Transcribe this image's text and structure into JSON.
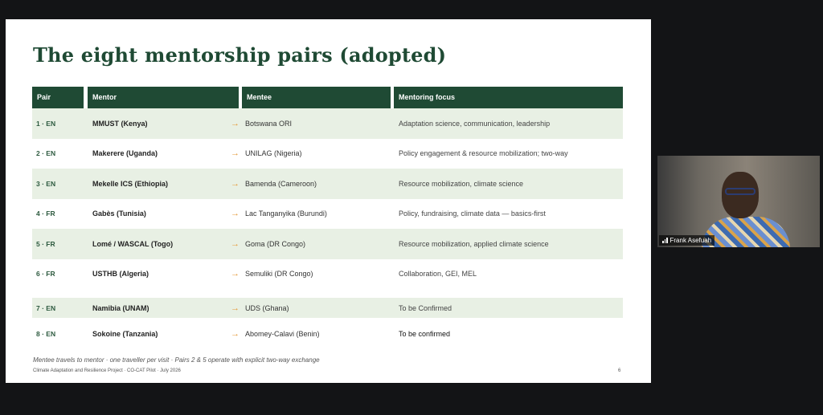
{
  "slide": {
    "title": "The eight mentorship pairs (adopted)",
    "headers": {
      "pair": "Pair",
      "mentor": "Mentor",
      "mentee": "Mentee",
      "focus": "Mentoring focus"
    },
    "rows": [
      {
        "pair": "1 · EN",
        "mentor": "MMUST (Kenya)",
        "mentee": "Botswana ORI",
        "focus": "Adaptation science, communication, leadership"
      },
      {
        "pair": "2 · EN",
        "mentor": "Makerere (Uganda)",
        "mentee": "UNILAG (Nigeria)",
        "focus": "Policy engagement & resource mobilization; two-way"
      },
      {
        "pair": "3 · EN",
        "mentor": "Mekelle ICS (Ethiopia)",
        "mentee": "Bamenda (Cameroon)",
        "focus": "Resource mobilization, climate science"
      },
      {
        "pair": "4 · FR",
        "mentor": "Gabès (Tunisia)",
        "mentee": "Lac Tanganyika (Burundi)",
        "focus": "Policy, fundraising, climate data — basics-first"
      },
      {
        "pair": "5 · FR",
        "mentor": "Lomé / WASCAL (Togo)",
        "mentee": "Goma (DR Congo)",
        "focus": "Resource mobilization, applied climate science"
      },
      {
        "pair": "6 · FR",
        "mentor": "USTHB (Algeria)",
        "mentee": "Semuliki (DR Congo)",
        "focus": "Collaboration, GEI, MEL"
      },
      {
        "pair": "7 · EN",
        "mentor": "Namibia (UNAM)",
        "mentee": "UDS (Ghana)",
        "focus": "To be Confirmed"
      },
      {
        "pair": "8 · EN",
        "mentor": "Sokoine (Tanzania)",
        "mentee": "Abomey-Calavi (Benin)",
        "focus": "To be confirmed"
      }
    ],
    "arrow": "→",
    "footnote": "Mentee travels to mentor · one traveller per visit · Pairs 2 & 5 operate with explicit two-way exchange",
    "footer": "Climate Adaptation and Resilience Project · CO-CAT Pilot · July 2026",
    "page_number": "6"
  },
  "video": {
    "participant_name": "Frank Asefuah",
    "icon": "signal-bars-icon"
  },
  "colors": {
    "header_bg": "#1f4a34",
    "shaded_row": "#e8f0e4",
    "arrow": "#e59a3a",
    "title": "#1f4a34"
  }
}
